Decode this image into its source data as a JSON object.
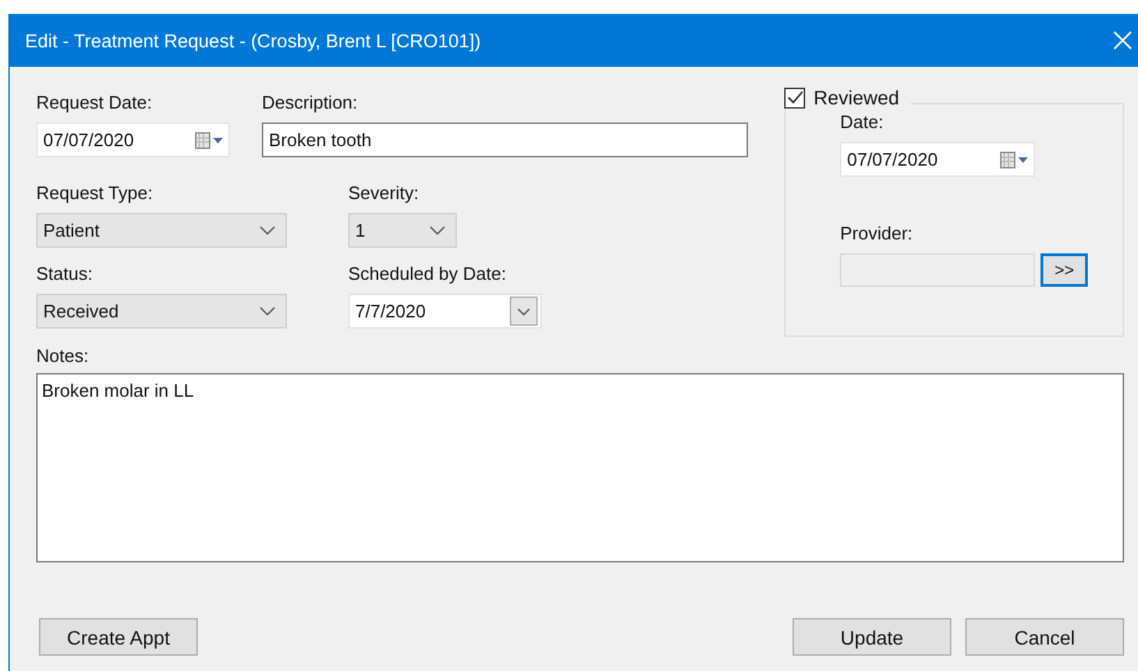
{
  "window": {
    "title": "Edit - Treatment Request - (Crosby, Brent L [CRO101])"
  },
  "request_date": {
    "label": "Request Date:",
    "value": "07/07/2020"
  },
  "description": {
    "label": "Description:",
    "value": "Broken tooth"
  },
  "request_type": {
    "label": "Request Type:",
    "value": "Patient"
  },
  "severity": {
    "label": "Severity:",
    "value": "1"
  },
  "status": {
    "label": "Status:",
    "value": "Received"
  },
  "scheduled_by_date": {
    "label": "Scheduled by Date:",
    "value": "7/7/2020"
  },
  "reviewed": {
    "label": "Reviewed",
    "checked": true,
    "date": {
      "label": "Date:",
      "value": "07/07/2020"
    },
    "provider": {
      "label": "Provider:",
      "button": ">>",
      "button_focused": true
    }
  },
  "notes": {
    "label": "Notes:",
    "value": "Broken molar in LL"
  },
  "left_buttons": [
    "Create Appt"
  ],
  "right_buttons": [
    "Update",
    "Cancel"
  ]
}
